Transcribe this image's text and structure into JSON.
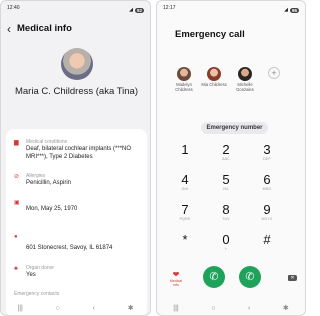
{
  "left": {
    "status": {
      "time": "12:40",
      "battery": "92"
    },
    "title": "Medical info",
    "name": "Maria C. Childress (aka Tina)",
    "items": [
      {
        "label": "Medical conditions",
        "value": "Deaf, bilateral cochlear implants (***NO MRI***), Type 2 Diabetes"
      },
      {
        "label": "Allergies",
        "value": "Penicillin, Aspirin"
      },
      {
        "label": "",
        "value": "Mon, May 25, 1970"
      },
      {
        "label": "",
        "value": "601 Stonecrest, Savoy, IL 61874"
      },
      {
        "label": "Organ donor",
        "value": "Yes"
      },
      {
        "label": "Emergency contacts",
        "value": ""
      }
    ]
  },
  "right": {
    "status": {
      "time": "12:17",
      "battery": "95"
    },
    "title": "Emergency call",
    "contacts": [
      "Madelyn Childress",
      "Mia Childress",
      "Michelle Gonzales"
    ],
    "emergency_number_label": "Emergency number",
    "keys": [
      {
        "d": "1",
        "l": ""
      },
      {
        "d": "2",
        "l": "ABC"
      },
      {
        "d": "3",
        "l": "DEF"
      },
      {
        "d": "4",
        "l": "GHI"
      },
      {
        "d": "5",
        "l": "JKL"
      },
      {
        "d": "6",
        "l": "MNO"
      },
      {
        "d": "7",
        "l": "PQRS"
      },
      {
        "d": "8",
        "l": "TUV"
      },
      {
        "d": "9",
        "l": "WXYZ"
      },
      {
        "d": "*",
        "l": ""
      },
      {
        "d": "0",
        "l": "+"
      },
      {
        "d": "#",
        "l": ""
      }
    ],
    "medical_label": "Medical info"
  },
  "colors": {
    "accent_red": "#d23b3b",
    "call_green": "#1fa35a"
  }
}
